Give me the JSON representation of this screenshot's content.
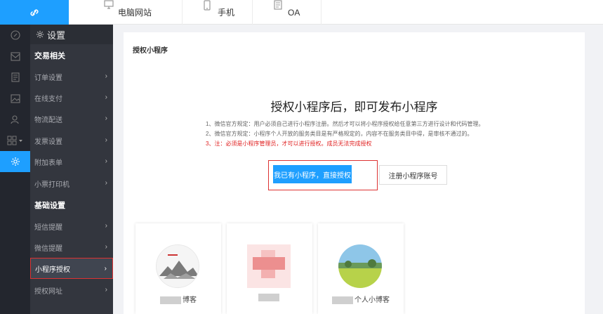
{
  "topbar": {
    "logo_icon": "link-icon",
    "tabs": [
      {
        "label": "电脑网站",
        "icon": "monitor-icon"
      },
      {
        "label": "手机",
        "icon": "phone-icon"
      },
      {
        "label": "OA",
        "icon": "document-icon"
      }
    ]
  },
  "rail": {
    "items": [
      "link-icon",
      "mail-icon",
      "document-icon",
      "image-icon",
      "user-icon",
      "grid-icon",
      "gear-icon"
    ],
    "active_index": 6
  },
  "submenu": {
    "title": "设置",
    "sections": [
      {
        "label": "交易相关",
        "items": [
          "订单设置",
          "在线支付",
          "物流配送",
          "发票设置",
          "附加表单",
          "小票打印机"
        ]
      },
      {
        "label": "基础设置",
        "items": [
          "短信提醒",
          "微信提醒",
          "小程序授权",
          "授权网址"
        ]
      }
    ],
    "active_item": "小程序授权"
  },
  "main": {
    "card_title": "授权小程序",
    "headline": "授权小程序后，即可发布小程序",
    "rules": [
      "1、微信官方规定：用户必须自己进行小程序注册。然后才可以将小程序授权给任意第三方进行设计和代码管理。",
      "2、微信官方规定：小程序个人开放的服务类目是有严格规定的，内容不在服务类目中得，是审核不通过的。",
      "3、注：必须是小程序管理员，才可以进行授权。成员无法完成授权"
    ],
    "primary_button": "我已有小程序，直接授权",
    "secondary_button": "注册小程序账号",
    "mini_programs": [
      {
        "name": "博客"
      },
      {
        "name": ""
      },
      {
        "name": "个人小博客"
      }
    ]
  },
  "colors": {
    "accent": "#1e9fff",
    "rail_bg": "#23262e",
    "submenu_bg": "#33363e",
    "highlight_border": "#dd3333",
    "warning_text": "#e02020"
  }
}
